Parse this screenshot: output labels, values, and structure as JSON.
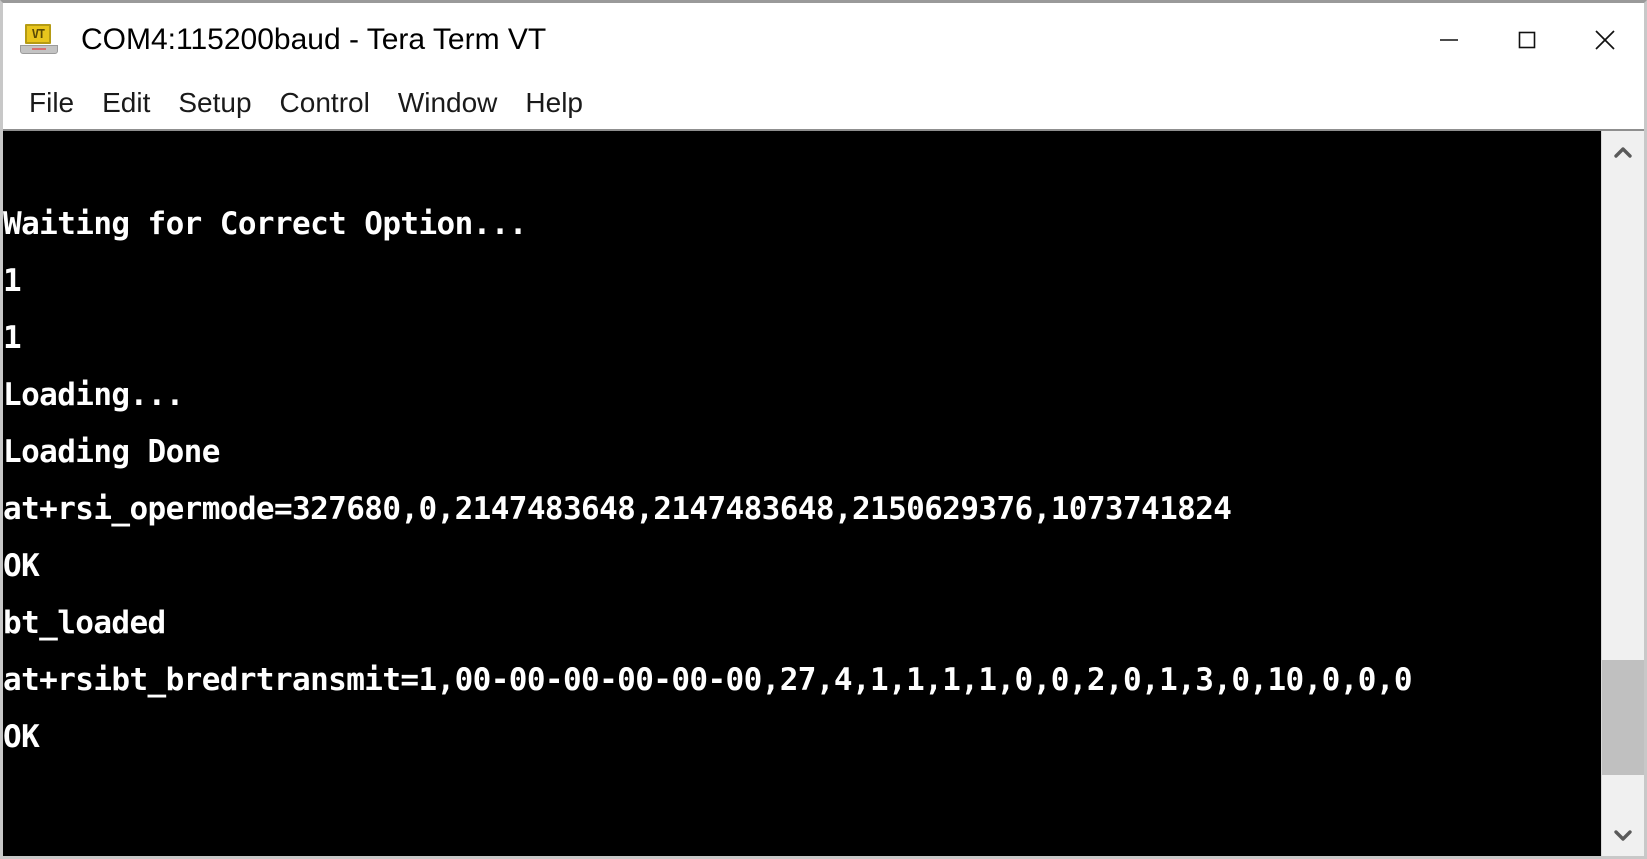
{
  "window": {
    "title": "COM4:115200baud - Tera Term VT",
    "icon": "laptop-terminal-icon",
    "icon_text": "VT",
    "controls": {
      "minimize": "minimize-icon",
      "maximize": "maximize-icon",
      "close": "close-icon"
    }
  },
  "menu": {
    "items": [
      {
        "label": "File"
      },
      {
        "label": "Edit"
      },
      {
        "label": "Setup"
      },
      {
        "label": "Control"
      },
      {
        "label": "Window"
      },
      {
        "label": "Help"
      }
    ]
  },
  "terminal": {
    "background_color": "#000000",
    "foreground_color": "#FFFFFF",
    "lines": [
      "",
      "Waiting for Correct Option...",
      "1",
      "1",
      "Loading...",
      "Loading Done",
      "at+rsi_opermode=327680,0,2147483648,2147483648,2150629376,1073741824",
      "OK",
      "bt_loaded",
      "at+rsibt_bredrtransmit=1,00-00-00-00-00-00,27,4,1,1,1,1,0,0,2,0,1,3,0,10,0,0,0",
      "OK"
    ]
  },
  "scrollbar": {
    "up_arrow": "chevron-up-icon",
    "down_arrow": "chevron-down-icon",
    "thumb_top_percent": 76,
    "thumb_height_percent": 18,
    "track_color": "#F0F0F0",
    "thumb_color": "#C0C0C0"
  }
}
